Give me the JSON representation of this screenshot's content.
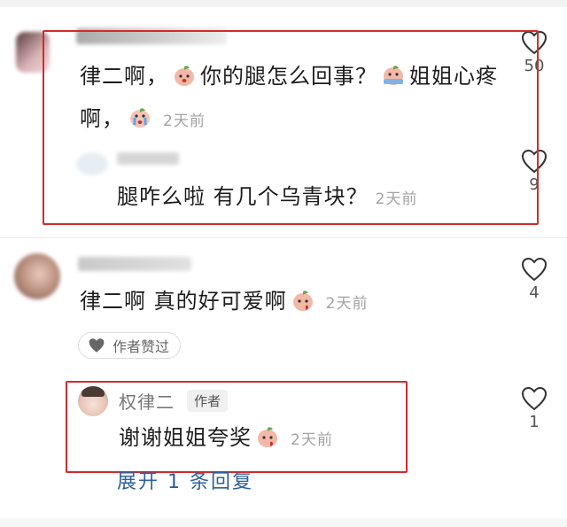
{
  "comments": [
    {
      "text_line1": "律二啊，",
      "text_mid1": "你的腿怎么回事？",
      "text_mid2": "姐姐心疼",
      "text_line2": "啊，",
      "time": "2天前",
      "likes": "50"
    },
    {
      "text": "腿咋么啦 有几个乌青块？",
      "time": "2天前",
      "likes": "9"
    },
    {
      "text": "律二啊 真的好可爱啊",
      "time": "2天前",
      "likes": "4",
      "liked_by_author_label": "作者赞过"
    },
    {
      "username": "权律二",
      "author_tag": "作者",
      "text": "谢谢姐姐夸奖",
      "time": "2天前",
      "likes": "1"
    }
  ],
  "expand_replies_label": "展开 1 条回复",
  "colors": {
    "highlight_box": "#d42a2a",
    "link": "#2d5f9e",
    "time": "#a3a3a3"
  }
}
